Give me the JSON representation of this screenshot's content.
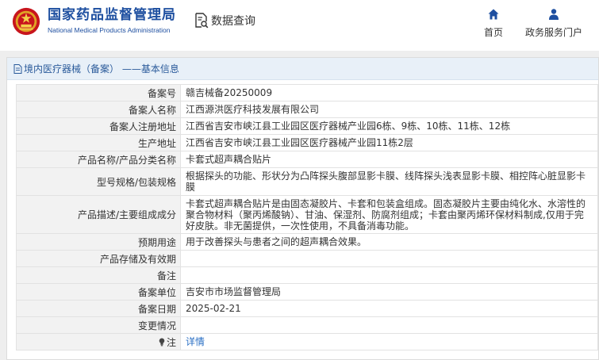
{
  "header": {
    "agency_cn": "国家药品监督管理局",
    "agency_en": "National Medical Products Administration",
    "query_label": "数据查询",
    "nav": [
      {
        "label": "首页",
        "icon": "home-icon"
      },
      {
        "label": "政务服务门户",
        "icon": "user-icon"
      }
    ]
  },
  "panel": {
    "title": "境内医疗器械（备案） ——基本信息"
  },
  "record": {
    "rows": [
      {
        "label": "备案号",
        "value": "赣吉械备20250009"
      },
      {
        "label": "备案人名称",
        "value": "江西源洪医疗科技发展有限公司"
      },
      {
        "label": "备案人注册地址",
        "value": "江西省吉安市峡江县工业园区医疗器械产业园6栋、9栋、10栋、11栋、12栋"
      },
      {
        "label": "生产地址",
        "value": "江西省吉安市峡江县工业园区医疗器械产业园11栋2层"
      },
      {
        "label": "产品名称/产品分类名称",
        "value": "卡套式超声耦合贴片"
      },
      {
        "label": "型号规格/包装规格",
        "value": "根据探头的功能、形状分为凸阵探头腹部显影卡膜、线阵探头浅表显影卡膜、相控阵心脏显影卡膜"
      },
      {
        "label": "产品描述/主要组成成分",
        "value": "卡套式超声耦合贴片是由固态凝胶片、卡套和包装盒组成。固态凝胶片主要由纯化水、水溶性的聚合物材料（聚丙烯酸钠）、甘油、保湿剂、防腐剂组成；卡套由聚丙烯环保材料制成,仅用于完好皮肤。非无菌提供，一次性使用，不具备消毒功能。"
      },
      {
        "label": "预期用途",
        "value": "用于改善探头与患者之间的超声耦合效果。"
      },
      {
        "label": "产品存储及有效期",
        "value": ""
      },
      {
        "label": "备注",
        "value": ""
      },
      {
        "label": "备案单位",
        "value": "吉安市市场监督管理局"
      },
      {
        "label": "备案日期",
        "value": "2025-02-21"
      },
      {
        "label": "变更情况",
        "value": ""
      },
      {
        "label": "注",
        "value": "详情",
        "icon": "lightbulb-icon"
      }
    ]
  },
  "colors": {
    "brand": "#1e4fa0",
    "emblem_red": "#c8151d",
    "link": "#2a6fc4",
    "title_bg": "#e8f0f8"
  }
}
